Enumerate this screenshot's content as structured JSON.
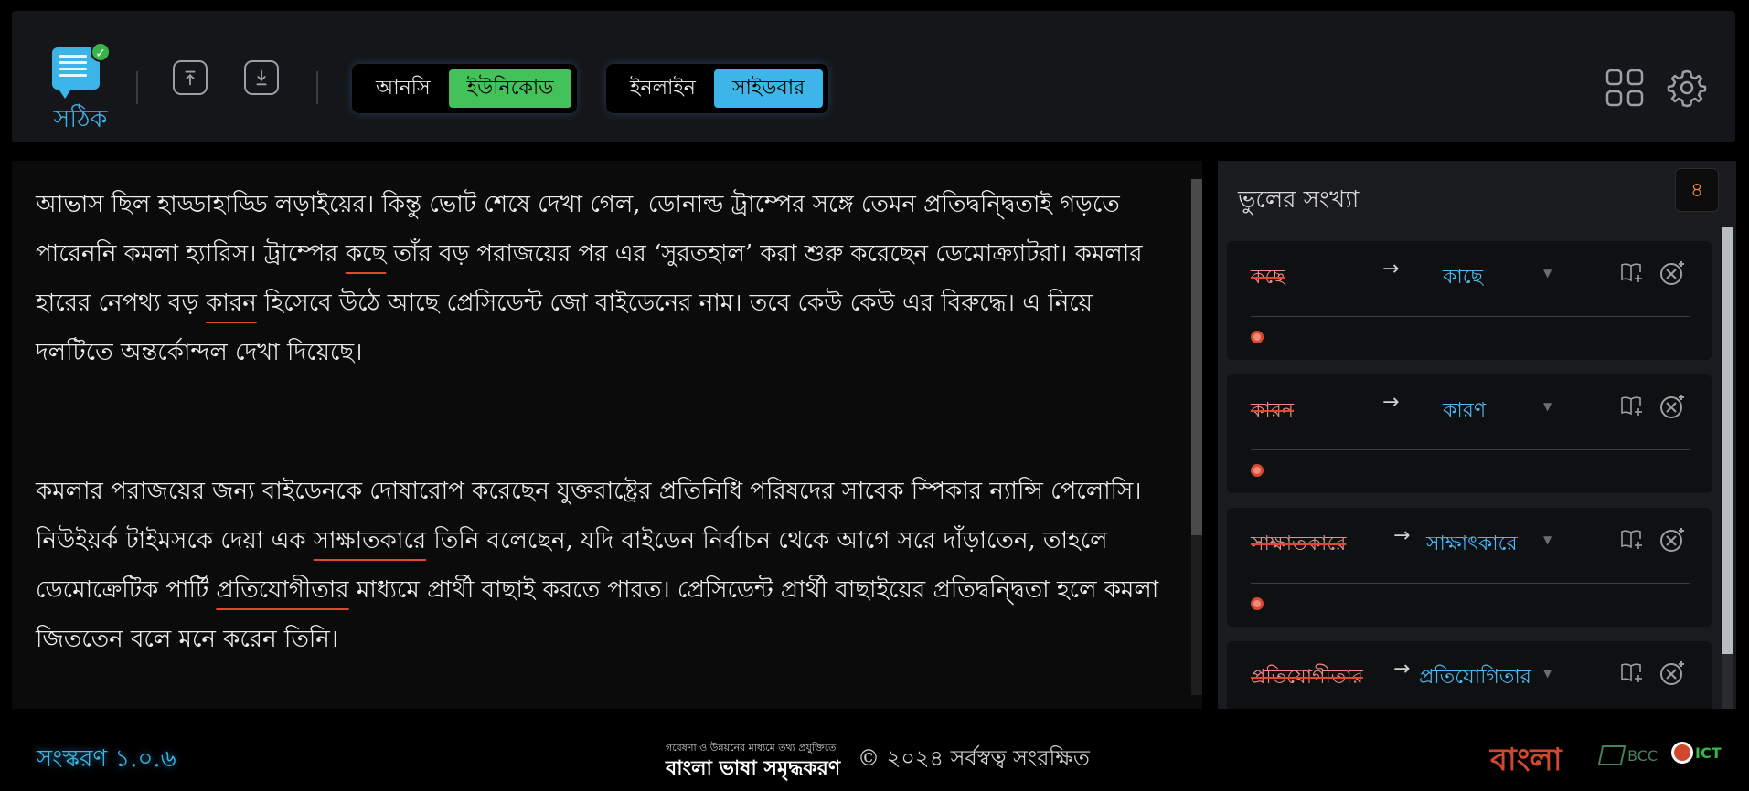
{
  "app": {
    "logo_text": "সঠিক"
  },
  "header": {
    "encoding_toggle": {
      "option_1": "আনসি",
      "option_2": "ইউনিকোড",
      "active": "ইউনিকোড"
    },
    "view_toggle": {
      "option_1": "ইনলাইন",
      "option_2": "সাইডবার",
      "active": "সাইডবার"
    },
    "icons": [
      "upload-icon",
      "download-icon",
      "grid-icon",
      "gear-icon"
    ]
  },
  "editor": {
    "para1": {
      "s1": "আভাস ছিল হাড্ডাহাড্ডি লড়াইয়ের। কিন্তু ভোট শেষে দেখা গেল, ডোনাল্ড ট্রাম্পের সঙ্গে তেমন প্রতিদ্বন্দ্বিতাই গড়তে পারেননি কমলা হ্যারিস। ট্রাম্পের ",
      "e1": "কছে",
      "s2": " তাঁর বড় পরাজয়ের পর এর ‘সুরতহাল’ করা শুরু করেছেন ডেমোক্র্যাটরা। কমলার হারের নেপথ্য বড় ",
      "e2": "কারন",
      "s3": " হিসেবে উঠে আছে প্রেসিডেন্ট জো বাইডেনের নাম। তবে কেউ কেউ এর বিরুদ্ধে। এ নিয়ে দলটিতে অন্তর্কোন্দল দেখা দিয়েছে।"
    },
    "para2": {
      "s1": "কমলার পরাজয়ের জন্য বাইডেনকে দোষারোপ করেছেন যুক্তরাষ্ট্রের প্রতিনিধি পরিষদের সাবেক স্পিকার ন্যান্সি পেলোসি। নিউইয়র্ক টাইমসকে দেয়া এক ",
      "e1": "সাক্ষাতকারে",
      "s2": " তিনি বলেছেন, যদি বাইডেন নির্বাচন থেকে আগে সরে দাঁড়াতেন, তাহলে ডেমোক্রেটিক পার্টি ",
      "e2": "প্রতিযোগীতার",
      "s3": " মাধ্যমে প্রার্থী বাছাই করতে পারত। প্রেসিডেন্ট প্রার্থী বাছাইয়ের প্রতিদ্বন্দ্বিতা হলে কমলা জিততেন বলে মনে করেন তিনি।"
    }
  },
  "sidebar": {
    "title": "ভুলের সংখ্যা",
    "count": "৪",
    "errors": [
      {
        "wrong": "কছে",
        "suggestion": "কাছে"
      },
      {
        "wrong": "কারন",
        "suggestion": "কারণ"
      },
      {
        "wrong": "সাক্ষাতকারে",
        "suggestion": "সাক্ষাৎকারে"
      },
      {
        "wrong": "প্রতিযোগীতার",
        "suggestion": "প্রতিযোগিতার"
      }
    ]
  },
  "footer": {
    "version": "সংস্করণ ১.০.৬",
    "brand_tagline": "গবেষণা ও উন্নয়নের মাধ্যমে তথ্য প্রযুক্তিতে",
    "brand_name": "বাংলা ভাষা সমৃদ্ধকরণ",
    "copyright": "© ২০২৪ সর্বস্বত্ব সংরক্ষিত",
    "partner_logo_1": "বাংলা",
    "partner_logo_2": "BCC",
    "partner_logo_3": "ICT"
  },
  "colors": {
    "accent_blue": "#3cb4e8",
    "accent_green": "#43c15a",
    "error_red": "#e0492f",
    "count_orange": "#f08a3c"
  }
}
